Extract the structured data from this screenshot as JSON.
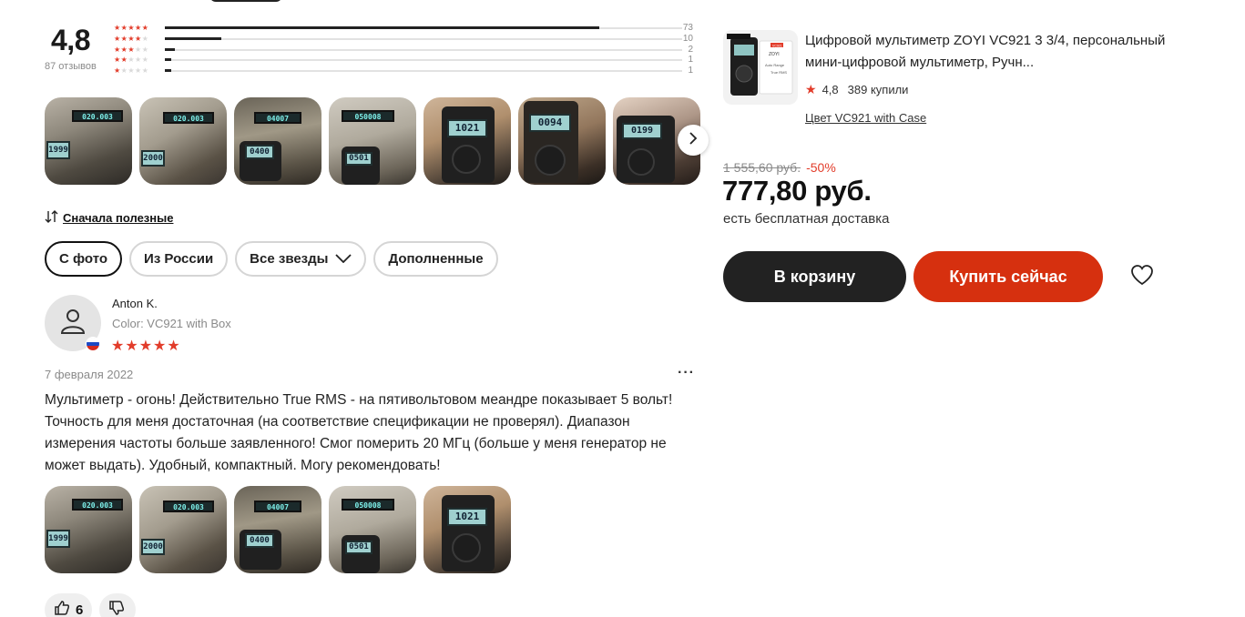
{
  "summary": {
    "score": "4,8",
    "reviews_count": "87 отзывов",
    "distribution": [
      {
        "stars": 5,
        "count": "73",
        "fraction": 0.84
      },
      {
        "stars": 4,
        "count": "10",
        "fraction": 0.11
      },
      {
        "stars": 3,
        "count": "2",
        "fraction": 0.02
      },
      {
        "stars": 2,
        "count": "1",
        "fraction": 0.01
      },
      {
        "stars": 1,
        "count": "1",
        "fraction": 0.01
      }
    ]
  },
  "gallery": {
    "next_icon": "chevron-right-icon",
    "photos": [
      "photo-1",
      "photo-2",
      "photo-3",
      "photo-4",
      "photo-5",
      "photo-6",
      "photo-7"
    ]
  },
  "sort": {
    "label": "Сначала полезные",
    "icon": "sort-icon"
  },
  "filters": [
    {
      "label": "С фото",
      "active": true
    },
    {
      "label": "Из России",
      "active": false
    },
    {
      "label": "Все звезды",
      "active": false,
      "dropdown": true
    },
    {
      "label": "Дополненные",
      "active": false
    }
  ],
  "review": {
    "author": "Anton K.",
    "variant": "Color: VC921 with Box",
    "rating": 5,
    "stars": "★★★★★",
    "date": "7 февраля 2022",
    "more": "···",
    "text": "Мультиметр - огонь! Действительно True RMS - на пятивольтовом меандре показывает 5 вольт! Точность для меня достаточная (на соответствие спецификации не проверял). Диапазон измерения частоты больше заявленного! Смог померить 20 МГц (больше у меня генератор не может выдать). Удобный, компактный. Могу рекомендовать!",
    "likes": "6",
    "like_icon": "thumbs-up-icon",
    "dislike_icon": "thumbs-down-icon"
  },
  "product": {
    "title": "Цифровой мультиметр ZOYI VC921 3 3/4, персональный мини-цифровой мультиметр, Ручн...",
    "rating": "4,8",
    "sold": "389 купили",
    "color": "Цвет VC921 with Case",
    "old_price": "1 555,60 руб.",
    "discount": "-50%",
    "price": "777,80 руб.",
    "delivery": "есть бесплатная доставка",
    "cart_label": "В корзину",
    "buy_label": "Купить сейчас",
    "wishlist_icon": "heart-icon",
    "image_label_brand": "ZOYI",
    "image_label_model": "VC921",
    "image_label_auto": "Auto Range",
    "image_label_rms": "True RMS"
  },
  "lcd_readings": {
    "p1_top": "020.003",
    "p1_bot": "1999",
    "p2_top": "020.003",
    "p2_bot": "2000",
    "p3_top": "04007",
    "p3_bot": "0400",
    "p4_top": "050008",
    "p4_bot": "0501",
    "p5": "1021",
    "p6": "0094",
    "p7": "0199"
  },
  "colors": {
    "accent": "#d6300f",
    "star": "#e23c2a",
    "dark": "#222222"
  }
}
